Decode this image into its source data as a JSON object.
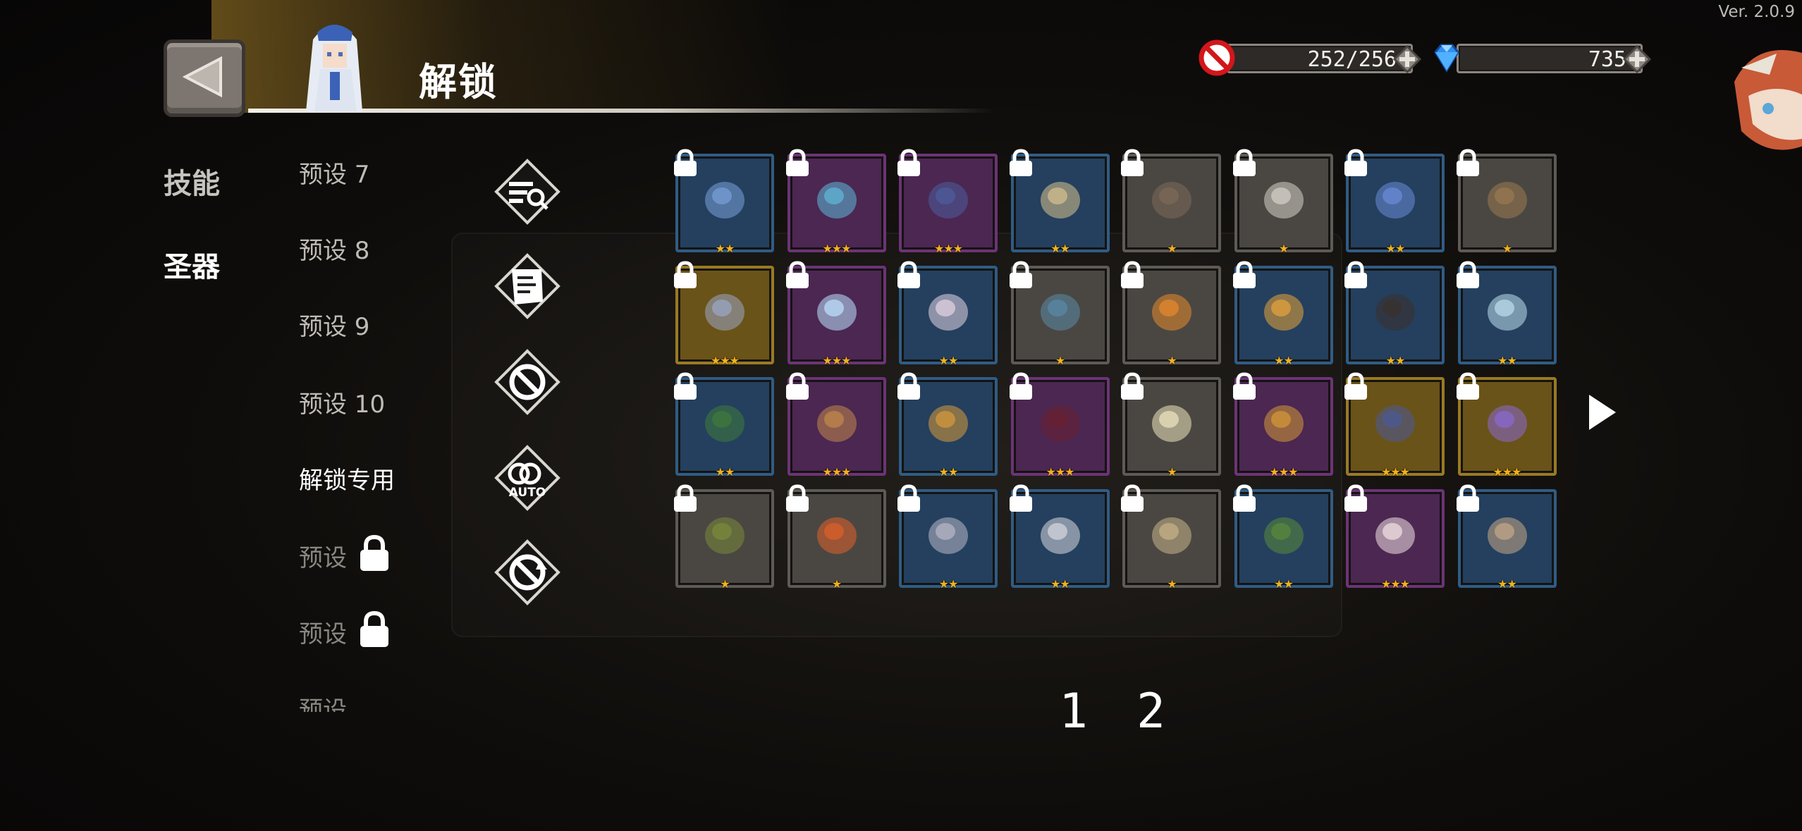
{
  "version": "Ver. 2.0.9",
  "header": {
    "title": "解锁"
  },
  "resources": {
    "stamina": {
      "value": "252/256",
      "icon": "no-entry-icon"
    },
    "gems": {
      "value": "735",
      "icon": "blue-gem-icon"
    }
  },
  "categories": [
    {
      "label": "技能",
      "active": false
    },
    {
      "label": "圣器",
      "active": true
    }
  ],
  "presets": [
    {
      "label": "预设 7",
      "locked": false,
      "active": false
    },
    {
      "label": "预设 8",
      "locked": false,
      "active": false
    },
    {
      "label": "预设 9",
      "locked": false,
      "active": false
    },
    {
      "label": "预设 10",
      "locked": false,
      "active": false
    },
    {
      "label": "解锁专用",
      "locked": false,
      "active": true
    },
    {
      "label": "预设",
      "locked": true,
      "active": false
    },
    {
      "label": "预设",
      "locked": true,
      "active": false
    },
    {
      "label": "预设",
      "locked": true,
      "active": false
    }
  ],
  "tools": [
    {
      "name": "filter-search-icon"
    },
    {
      "name": "scroll-list-icon"
    },
    {
      "name": "ban-icon"
    },
    {
      "name": "auto-icon",
      "label": "AUTO"
    },
    {
      "name": "reset-icon"
    }
  ],
  "relics": [
    {
      "name": "bottle-relic",
      "rarity": "blue",
      "stars": 2,
      "locked": true
    },
    {
      "name": "syringe-relic",
      "rarity": "purple",
      "stars": 3,
      "locked": true
    },
    {
      "name": "battery-relic",
      "rarity": "purple",
      "stars": 3,
      "locked": true
    },
    {
      "name": "skull-mask-relic",
      "rarity": "blue",
      "stars": 2,
      "locked": true
    },
    {
      "name": "stone-relic",
      "rarity": "gray",
      "stars": 1,
      "locked": true
    },
    {
      "name": "feather-relic",
      "rarity": "gray",
      "stars": 1,
      "locked": true
    },
    {
      "name": "crescent-blade-relic",
      "rarity": "blue",
      "stars": 2,
      "locked": true
    },
    {
      "name": "arrow-relic",
      "rarity": "gray",
      "stars": 1,
      "locked": true
    },
    {
      "name": "pocket-watch-relic",
      "rarity": "gold",
      "stars": 3,
      "locked": true
    },
    {
      "name": "cloud-orb-relic",
      "rarity": "purple",
      "stars": 3,
      "locked": true
    },
    {
      "name": "crystal-relic",
      "rarity": "blue",
      "stars": 2,
      "locked": true
    },
    {
      "name": "flask-relic",
      "rarity": "gray",
      "stars": 1,
      "locked": true
    },
    {
      "name": "carrot-relic",
      "rarity": "gray",
      "stars": 1,
      "locked": true
    },
    {
      "name": "planet-relic",
      "rarity": "blue",
      "stars": 2,
      "locked": true
    },
    {
      "name": "dark-rock-relic",
      "rarity": "blue",
      "stars": 2,
      "locked": true
    },
    {
      "name": "ice-spirit-relic",
      "rarity": "blue",
      "stars": 2,
      "locked": true
    },
    {
      "name": "green-gem-relic",
      "rarity": "blue",
      "stars": 2,
      "locked": true
    },
    {
      "name": "treasure-chest-relic",
      "rarity": "purple",
      "stars": 3,
      "locked": true
    },
    {
      "name": "gold-ring-relic",
      "rarity": "blue",
      "stars": 2,
      "locked": true
    },
    {
      "name": "dark-glove-relic",
      "rarity": "purple",
      "stars": 3,
      "locked": true
    },
    {
      "name": "light-orb-relic",
      "rarity": "gray",
      "stars": 1,
      "locked": true
    },
    {
      "name": "gear-relic",
      "rarity": "purple",
      "stars": 3,
      "locked": true
    },
    {
      "name": "spellbook-relic",
      "rarity": "gold",
      "stars": 3,
      "locked": true
    },
    {
      "name": "purple-rune-relic",
      "rarity": "gold",
      "stars": 3,
      "locked": true
    },
    {
      "name": "leaf-hat-relic",
      "rarity": "gray",
      "stars": 1,
      "locked": true
    },
    {
      "name": "fire-orb-relic",
      "rarity": "gray",
      "stars": 1,
      "locked": true
    },
    {
      "name": "coin-relic",
      "rarity": "blue",
      "stars": 2,
      "locked": true
    },
    {
      "name": "winged-gear-relic",
      "rarity": "blue",
      "stars": 2,
      "locked": true
    },
    {
      "name": "rosary-relic",
      "rarity": "gray",
      "stars": 1,
      "locked": true
    },
    {
      "name": "leaf-sprout-relic",
      "rarity": "blue",
      "stars": 2,
      "locked": true
    },
    {
      "name": "cake-relic",
      "rarity": "purple",
      "stars": 3,
      "locked": true
    },
    {
      "name": "compass-relic",
      "rarity": "blue",
      "stars": 2,
      "locked": true
    }
  ],
  "rarity_colors": {
    "gray": "#4a4743",
    "blue": "#24405e",
    "purple": "#4b2752",
    "gold": "#6a5318"
  },
  "pagination": {
    "pages": [
      "1",
      "2"
    ]
  }
}
